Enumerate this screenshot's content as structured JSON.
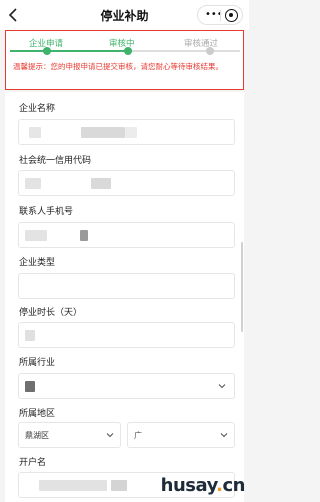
{
  "nav": {
    "title": "停业补助",
    "more_icon": "more-dots-icon",
    "close_icon": "target-icon",
    "back_icon": "back-chevron-icon"
  },
  "status": {
    "steps": [
      {
        "label": "企业申请",
        "state": "done"
      },
      {
        "label": "审核中",
        "state": "current"
      },
      {
        "label": "审核通过",
        "state": "pending"
      }
    ],
    "notice": "温馨提示：您的申报申请已提交审核，请您耐心等待审核结果。",
    "accent_color": "#3fb36b",
    "alert_color": "#e83a2f"
  },
  "form": {
    "company_name_label": "企业名称",
    "credit_code_label": "社会统一信用代码",
    "phone_label": "联系人手机号",
    "company_type_label": "企业类型",
    "suspension_label": "停业时长（天）",
    "industry_label": "所属行业",
    "region_label": "所属地区",
    "region_district_value": "鼎湖区",
    "region_town_value": "广",
    "account_name_label": "开户名"
  },
  "watermark": {
    "main": "husay",
    "dot": ".",
    "tld": "cn"
  }
}
